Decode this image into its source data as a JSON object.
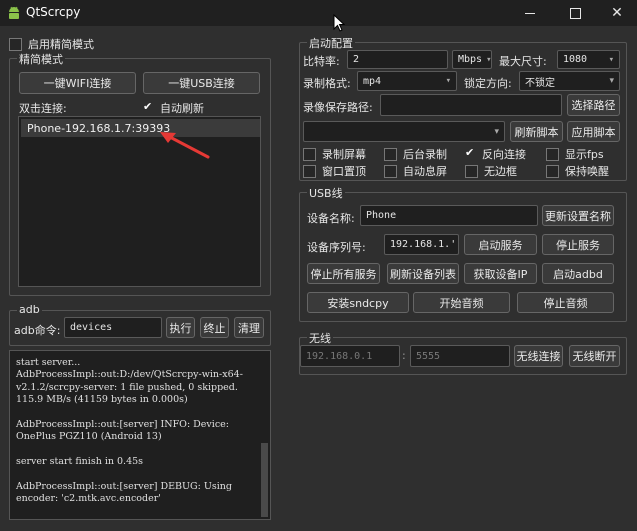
{
  "window": {
    "title": "QtScrcpy"
  },
  "simple_mode": {
    "enable_label": "启用精简模式",
    "enabled": false
  },
  "simple_group": {
    "title": "精简模式",
    "wifi_connect": "一键WIFI连接",
    "usb_connect": "一键USB连接",
    "double_click_label": "双击连接:",
    "auto_refresh_label": "自动刷新",
    "auto_refresh_checked": true,
    "devices": [
      "Phone-192.168.1.7:39393"
    ]
  },
  "adb_group": {
    "title": "adb",
    "command_label": "adb命令:",
    "command_value": "devices",
    "run": "执行",
    "stop": "终止",
    "clear": "清理"
  },
  "log": {
    "text": "start server...\nAdbProcessImpl::out:D:/dev/QtScrcpy-win-x64-v2.1.2/scrcpy-server: 1 file pushed, 0 skipped. 115.9 MB/s (41159 bytes in 0.000s)\n\nAdbProcessImpl::out:[server] INFO: Device: OnePlus PGZ110 (Android 13)\n\nserver start finish in 0.45s\n\nAdbProcessImpl::out:[server] DEBUG: Using encoder: 'c2.mtk.avc.encoder'"
  },
  "launch_group": {
    "title": "启动配置",
    "bitrate_label": "比特率:",
    "bitrate_value": "2",
    "bitrate_unit": "Mbps",
    "max_size_label": "最大尺寸:",
    "max_size_value": "1080",
    "record_format_label": "录制格式:",
    "record_format_value": "mp4",
    "lock_orientation_label": "锁定方向:",
    "lock_orientation_value": "不锁定",
    "record_path_label": "录像保存路径:",
    "record_path_value": "",
    "select_path": "选择路径",
    "script_value": "",
    "refresh_script": "刷新脚本",
    "apply_script": "应用脚本",
    "options": [
      {
        "label": "录制屏幕",
        "checked": false
      },
      {
        "label": "后台录制",
        "checked": false
      },
      {
        "label": "反向连接",
        "checked": true
      },
      {
        "label": "显示fps",
        "checked": false
      },
      {
        "label": "窗口置顶",
        "checked": false
      },
      {
        "label": "自动息屏",
        "checked": false
      },
      {
        "label": "无边框",
        "checked": false
      },
      {
        "label": "保持唤醒",
        "checked": false
      }
    ]
  },
  "usb_group": {
    "title": "USB线",
    "device_name_label": "设备名称:",
    "device_name_value": "Phone",
    "rename": "更新设置名称",
    "serial_label": "设备序列号:",
    "serial_value": "192.168.1.'",
    "start_service": "启动服务",
    "stop_service": "停止服务",
    "stop_all": "停止所有服务",
    "refresh_devices": "刷新设备列表",
    "get_ip": "获取设备IP",
    "start_adbd": "启动adbd",
    "install_sndcpy": "安装sndcpy",
    "start_audio": "开始音频",
    "stop_audio": "停止音频"
  },
  "wireless_group": {
    "title": "无线",
    "ip_placeholder": "192.168.0.1",
    "port_placeholder": "5555",
    "connect": "无线连接",
    "disconnect": "无线断开"
  }
}
